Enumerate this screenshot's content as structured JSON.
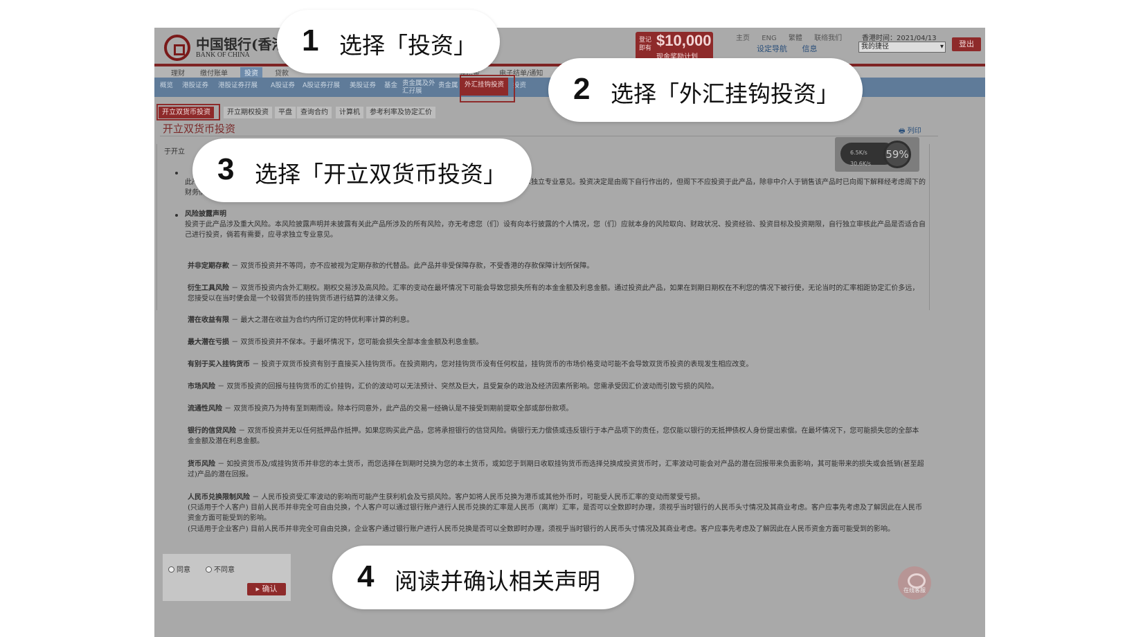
{
  "header": {
    "logo_cn": "中国银行(香港)",
    "logo_en": "BANK OF CHINA",
    "promo_small": "登记即有",
    "promo_amount": "$10,000",
    "promo_text": "现金奖励计划",
    "top_links": [
      "主页",
      "ENG",
      "繁體",
      "联络我们"
    ],
    "hk_time": "香港时间：2021/04/13",
    "links2": [
      "设定导航",
      "信息"
    ],
    "account_select": "我的捷径",
    "logout": "登出"
  },
  "nav1": [
    "理财",
    "缴付账单",
    "投资",
    "贷款",
    "强积金",
    "电子结单/通知"
  ],
  "nav1_active": "投资",
  "nav2": [
    "概览",
    "港股证券",
    "港股证券孖展",
    "A股证券",
    "A股证券孖展",
    "美股证券",
    "基金",
    "贵金属及外汇孖展",
    "贵金属",
    "外汇挂钩投资",
    "投资"
  ],
  "nav2_active": "外汇挂钩投资",
  "tabs3": [
    "开立双货币投资",
    "开立期权投资",
    "平盘",
    "查询合约",
    "计算机",
    "参考利率及协定汇价"
  ],
  "tabs3_active": "开立双货币投资",
  "page_title": "开立双货币投资",
  "print_label": "列印",
  "speed": {
    "up": "6.5K/s",
    "down": "30.6K/s",
    "percent": "59%"
  },
  "content": {
    "intro": "于开立",
    "para1": "此产品涉及风险，阁下须承担相关风险。倘若阁下对此产品涉及的风险有任何疑问，可要求中介人加以澄清或寻求独立专业意见。投资决定是由阁下自行作出的，但阁下不应投资于此产品，除非中介人于销售该产品时已向阁下解释经考虑阁下的财务情况、投资经验及目标后，此金融产品是适合阁下的。",
    "head2": "风险披露声明",
    "para2": "投资于此产品涉及重大风险。本风险披露声明并未披露有关此产品所涉及的所有风险，亦无考虑您（们）设有向本行披露的个人情况，您（们）应就本身的风险取向、财政状况、投资经验、投资目标及投资期限，自行独立审核此产品是否适合自己进行投资，倘若有需要，应寻求独立专业意见。",
    "risks": [
      {
        "title": "并非定期存款",
        "text": "－ 双货币投资并不等同，亦不应被视为定期存款的代替品。此产品并非受保障存款，不受香港的存款保障计划所保障。"
      },
      {
        "title": "衍生工具风险",
        "text": "－ 双货币投资内含外汇期权。期权交易涉及高风险。汇率的变动在最坏情况下可能会导致您损失所有的本金金额及利息金额。通过投资此产品，如果在到期日期权在不利您的情况下被行使，无论当时的汇率相距协定汇价多远，您接受以在当时便会是一个较弱货币的挂钩货币进行结算的法律义务。"
      },
      {
        "title": "潜在收益有限",
        "text": "－ 最大之潜在收益为合约内所订定的特优利率计算的利息。"
      },
      {
        "title": "最大潜在亏损",
        "text": "－ 双货币投资并不保本。于最坏情况下，您可能会损失全部本金金额及利息金额。"
      },
      {
        "title": "有别于买入挂钩货币",
        "text": "－ 投资于双货币投资有别于直接买入挂钩货币。在投资期内，您对挂钩货币没有任何权益，挂钩货币的市场价格变动可能不会导致双货币投资的表现发生相应改变。"
      },
      {
        "title": "市场风险",
        "text": "－ 双货币投资的回报与挂钩货币的汇价挂钩，汇价的波动可以无法预计、突然及巨大，且受复杂的政治及经济因素所影响。您需承受因汇价波动而引致亏损的风险。"
      },
      {
        "title": "流通性风险",
        "text": "－ 双货币投资乃为持有至到期而设。除本行同意外，此产品的交易一经确认是不接受到期前提取全部或部份款项。"
      },
      {
        "title": "银行的信贷风险",
        "text": "－ 双货币投资并无以任何抵押品作抵押。如果您购买此产品，您将承担银行的信贷风险。倘银行无力偿债或违反银行于本产品项下的责任，您仅能以银行的无抵押债权人身份提出索偿。在最坏情况下，您可能损失您的全部本金金额及潜在利息金额。"
      },
      {
        "title": "货币风险",
        "text": "－ 如投资货币及/或挂钩货币并非您的本土货币，而您选择在到期时兑换为您的本土货币，或如您于到期日收取挂钩货币而选择兑换成投资货币时，汇率波动可能会对产品的潜在回报带来负面影响，其可能带来的损失或会抵销(甚至超过)产品的潜在回报。"
      },
      {
        "title": "人民币兑换限制风险",
        "text": "－ 人民币投资受汇率波动的影响而可能产生获利机会及亏损风险。客户如将人民币兑换为港币或其他外币时，可能受人民币汇率的变动而蒙受亏损。"
      }
    ],
    "rmb_note1": "(只适用于个人客户) 目前人民币并非完全可自由兑换，个人客户可以通过银行账户进行人民币兑换的汇率是人民币（离岸）汇率，是否可以全数即时办理，须视乎当时银行的人民币头寸情况及其商业考虑。客户应事先考虑及了解因此在人民币资金方面可能受到的影响。",
    "rmb_note2": "(只适用于企业客户) 目前人民币并非完全可自由兑换，企业客户通过银行账户进行人民币兑换是否可以全数即时办理，须视乎当时银行的人民币头寸情况及其商业考虑。客户应事先考虑及了解因此在人民币资金方面可能受到的影响。"
  },
  "consent": {
    "agree": "同意",
    "disagree": "不同意",
    "confirm": "确认"
  },
  "chat_label": "在线客服",
  "callouts": [
    {
      "num": "1",
      "text": "选择「投资」"
    },
    {
      "num": "2",
      "text": "选择「外汇挂钩投资」"
    },
    {
      "num": "3",
      "text": "选择「开立双货币投资」"
    },
    {
      "num": "4",
      "text": "阅读并确认相关声明"
    }
  ]
}
